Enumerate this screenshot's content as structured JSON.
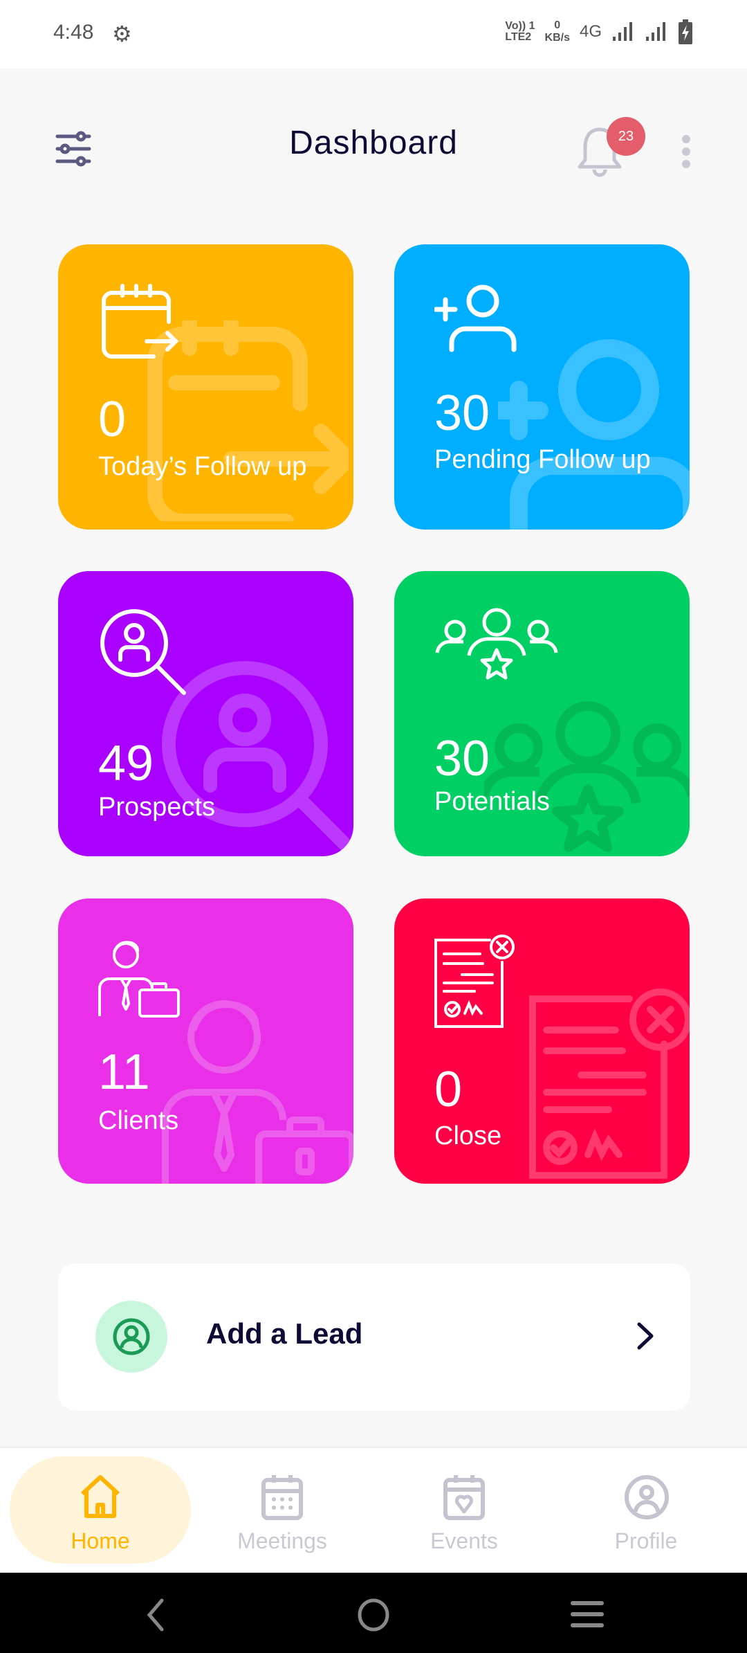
{
  "status_bar": {
    "time": "4:48",
    "network_type": "4G",
    "data_rate": "0",
    "data_unit": "KB/s",
    "volte": "Vo)) 1",
    "lte": "LTE2"
  },
  "header": {
    "title": "Dashboard",
    "notification_count": "23"
  },
  "cards": [
    {
      "value": "0",
      "label": "Today’s Follow up",
      "color": "#ffb400",
      "icon": "calendar-arrow-icon"
    },
    {
      "value": "30",
      "label": "Pending Follow up",
      "color": "#00aeff",
      "icon": "add-user-icon"
    },
    {
      "value": "49",
      "label": "Prospects",
      "color": "#aa00ff",
      "icon": "search-user-icon"
    },
    {
      "value": "30",
      "label": "Potentials",
      "color": "#00d063",
      "icon": "group-star-icon"
    },
    {
      "value": "11",
      "label": "Clients",
      "color": "#e92fe7",
      "icon": "businessman-icon"
    },
    {
      "value": "0",
      "label": "Close",
      "color": "#ff0044",
      "icon": "document-close-icon"
    }
  ],
  "add_lead": {
    "label": "Add a Lead"
  },
  "bottom_nav": [
    {
      "label": "Home",
      "active": true
    },
    {
      "label": "Meetings"
    },
    {
      "label": "Events"
    },
    {
      "label": "Profile"
    }
  ],
  "colors": {
    "accent": "#ffb400",
    "title": "#0b0b35",
    "badge": "#e35d6a"
  }
}
